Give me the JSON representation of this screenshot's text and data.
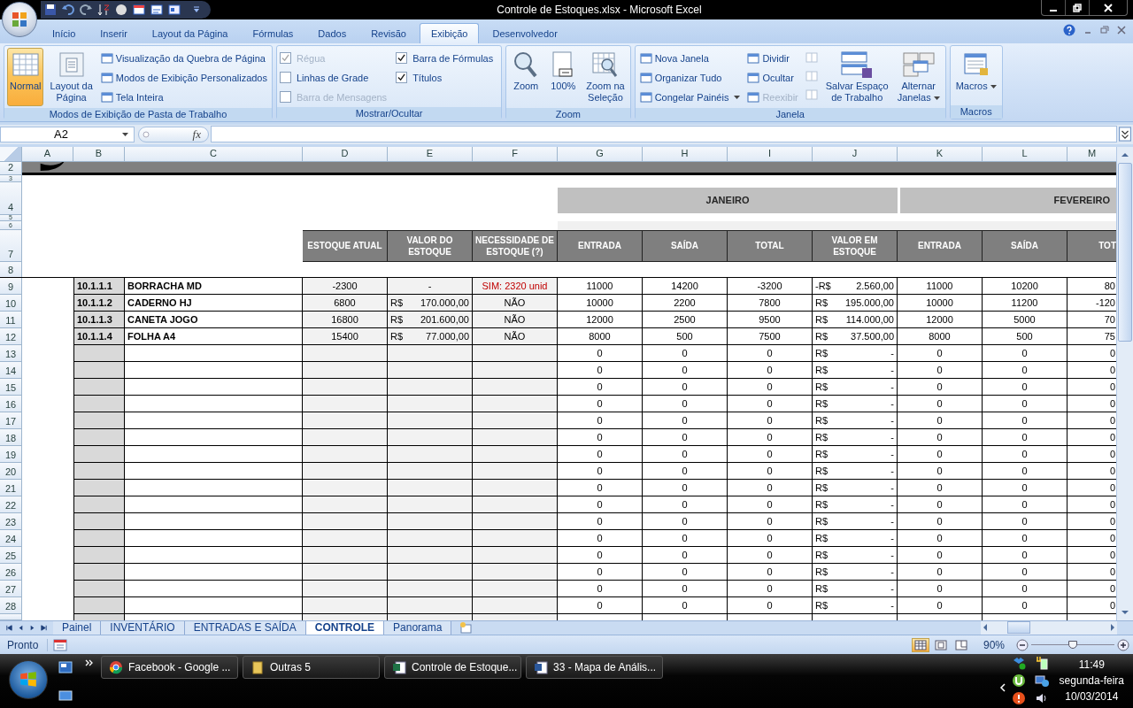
{
  "window": {
    "title": "Controle de Estoques.xlsx - Microsoft Excel"
  },
  "ribbon": {
    "tabs": [
      {
        "label": "Início",
        "selected": false
      },
      {
        "label": "Inserir",
        "selected": false
      },
      {
        "label": "Layout da Página",
        "selected": false
      },
      {
        "label": "Fórmulas",
        "selected": false
      },
      {
        "label": "Dados",
        "selected": false
      },
      {
        "label": "Revisão",
        "selected": false
      },
      {
        "label": "Exibição",
        "selected": true
      },
      {
        "label": "Desenvolvedor",
        "selected": false
      }
    ],
    "groups": [
      {
        "title": "Modos de Exibição de Pasta de Trabalho",
        "columns": [
          [
            {
              "kind": "large",
              "label": "Normal",
              "selected": true
            }
          ],
          [
            {
              "kind": "large",
              "label": "Layout da\nPágina",
              "selected": false
            }
          ],
          [
            {
              "kind": "small",
              "label": "Visualização da Quebra de Página"
            },
            {
              "kind": "small",
              "label": "Modos de Exibição Personalizados"
            },
            {
              "kind": "small",
              "label": "Tela Inteira"
            }
          ]
        ]
      },
      {
        "title": "Mostrar/Ocultar",
        "columns": [
          [
            {
              "kind": "checkbox",
              "label": "Régua",
              "checked": true,
              "disabled": true
            },
            {
              "kind": "checkbox",
              "label": "Linhas de Grade",
              "checked": false,
              "disabled": false
            },
            {
              "kind": "checkbox",
              "label": "Barra de Mensagens",
              "checked": false,
              "disabled": true
            }
          ],
          [
            {
              "kind": "checkbox",
              "label": "Barra de Fórmulas",
              "checked": true,
              "disabled": false
            },
            {
              "kind": "checkbox",
              "label": "Títulos",
              "checked": true,
              "disabled": false
            }
          ]
        ]
      },
      {
        "title": "Zoom",
        "columns": [
          [
            {
              "kind": "large",
              "label": "Zoom"
            }
          ],
          [
            {
              "kind": "large",
              "label": "100%"
            }
          ],
          [
            {
              "kind": "large",
              "label": "Zoom na\nSeleção"
            }
          ]
        ]
      },
      {
        "title": "Janela",
        "columns": [
          [
            {
              "kind": "small",
              "label": "Nova Janela",
              "disabled": false
            },
            {
              "kind": "small",
              "label": "Organizar Tudo",
              "disabled": false
            },
            {
              "kind": "small",
              "label": "Congelar Painéis",
              "dropdown": true,
              "disabled": false
            }
          ],
          [
            {
              "kind": "small",
              "label": "Dividir",
              "disabled": false
            },
            {
              "kind": "small",
              "label": "Ocultar",
              "disabled": false
            },
            {
              "kind": "small",
              "label": "Reexibir",
              "disabled": true
            }
          ],
          [
            {
              "kind": "icon",
              "disabled": true
            },
            {
              "kind": "icon",
              "disabled": true
            },
            {
              "kind": "icon",
              "disabled": true
            }
          ],
          [
            {
              "kind": "large",
              "label": "Salvar Espaço\nde Trabalho"
            }
          ],
          [
            {
              "kind": "large",
              "label": "Alternar\nJanelas",
              "dropdown": true
            }
          ]
        ]
      },
      {
        "title": "Macros",
        "columns": [
          [
            {
              "kind": "large",
              "label": "Macros",
              "dropdown": true
            }
          ]
        ]
      }
    ]
  },
  "formula_bar": {
    "name_box": "A2",
    "function_label": "fx"
  },
  "sheet": {
    "column_headers": [
      "A",
      "B",
      "C",
      "D",
      "E",
      "F",
      "G",
      "H",
      "I",
      "J",
      "K",
      "L",
      "M"
    ],
    "row_headers": [
      "2",
      "3",
      "4",
      "5",
      "6",
      "7",
      "8",
      "9",
      "10",
      "11",
      "12",
      "13",
      "14",
      "15",
      "16",
      "17",
      "18",
      "19",
      "20",
      "21",
      "22",
      "23",
      "24",
      "25",
      "26",
      "27",
      "28"
    ],
    "month_bands": [
      "JANEIRO",
      "FEVEREIRO"
    ],
    "summary_headers": [
      "ESTOQUE ATUAL",
      "VALOR DO ESTOQUE",
      "NECESSIDADE DE ESTOQUE (?)"
    ],
    "monthly_headers": [
      "ENTRADA",
      "SAÍDA",
      "TOTAL",
      "VALOR EM ESTOQUE",
      "ENTRADA",
      "SAÍDA",
      "TOT"
    ],
    "rows": [
      {
        "code": "10.1.1.1",
        "item": "BORRACHA MD",
        "stock": "-2300",
        "stock_value": {
          "amount": "-"
        },
        "need": "SIM: 2320 unid",
        "need_alert": true,
        "jan": [
          "11000",
          "14200",
          "-3200"
        ],
        "jan_value": {
          "currency": "-R$",
          "amount": "2.560,00"
        },
        "feb": [
          "11000",
          "10200",
          "80"
        ]
      },
      {
        "code": "10.1.1.2",
        "item": "CADERNO HJ",
        "stock": "6800",
        "stock_value": {
          "currency": "R$",
          "amount": "170.000,00"
        },
        "need": "NÃO",
        "need_alert": false,
        "jan": [
          "10000",
          "2200",
          "7800"
        ],
        "jan_value": {
          "currency": "R$",
          "amount": "195.000,00"
        },
        "feb": [
          "10000",
          "11200",
          "-120"
        ]
      },
      {
        "code": "10.1.1.3",
        "item": "CANETA JOGO",
        "stock": "16800",
        "stock_value": {
          "currency": "R$",
          "amount": "201.600,00"
        },
        "need": "NÃO",
        "need_alert": false,
        "jan": [
          "12000",
          "2500",
          "9500"
        ],
        "jan_value": {
          "currency": "R$",
          "amount": "114.000,00"
        },
        "feb": [
          "12000",
          "5000",
          "70"
        ]
      },
      {
        "code": "10.1.1.4",
        "item": "FOLHA A4",
        "stock": "15400",
        "stock_value": {
          "currency": "R$",
          "amount": "77.000,00"
        },
        "need": "NÃO",
        "need_alert": false,
        "jan": [
          "8000",
          "500",
          "7500"
        ],
        "jan_value": {
          "currency": "R$",
          "amount": "37.500,00"
        },
        "feb": [
          "8000",
          "500",
          "75"
        ]
      },
      {
        "jan": [
          "0",
          "0",
          "0"
        ],
        "jan_value": {
          "currency": "R$",
          "amount": "-"
        },
        "feb": [
          "0",
          "0",
          "0"
        ]
      },
      {
        "jan": [
          "0",
          "0",
          "0"
        ],
        "jan_value": {
          "currency": "R$",
          "amount": "-"
        },
        "feb": [
          "0",
          "0",
          "0"
        ]
      },
      {
        "jan": [
          "0",
          "0",
          "0"
        ],
        "jan_value": {
          "currency": "R$",
          "amount": "-"
        },
        "feb": [
          "0",
          "0",
          "0"
        ]
      },
      {
        "jan": [
          "0",
          "0",
          "0"
        ],
        "jan_value": {
          "currency": "R$",
          "amount": "-"
        },
        "feb": [
          "0",
          "0",
          "0"
        ]
      },
      {
        "jan": [
          "0",
          "0",
          "0"
        ],
        "jan_value": {
          "currency": "R$",
          "amount": "-"
        },
        "feb": [
          "0",
          "0",
          "0"
        ]
      },
      {
        "jan": [
          "0",
          "0",
          "0"
        ],
        "jan_value": {
          "currency": "R$",
          "amount": "-"
        },
        "feb": [
          "0",
          "0",
          "0"
        ]
      },
      {
        "jan": [
          "0",
          "0",
          "0"
        ],
        "jan_value": {
          "currency": "R$",
          "amount": "-"
        },
        "feb": [
          "0",
          "0",
          "0"
        ]
      },
      {
        "jan": [
          "0",
          "0",
          "0"
        ],
        "jan_value": {
          "currency": "R$",
          "amount": "-"
        },
        "feb": [
          "0",
          "0",
          "0"
        ]
      },
      {
        "jan": [
          "0",
          "0",
          "0"
        ],
        "jan_value": {
          "currency": "R$",
          "amount": "-"
        },
        "feb": [
          "0",
          "0",
          "0"
        ]
      },
      {
        "jan": [
          "0",
          "0",
          "0"
        ],
        "jan_value": {
          "currency": "R$",
          "amount": "-"
        },
        "feb": [
          "0",
          "0",
          "0"
        ]
      },
      {
        "jan": [
          "0",
          "0",
          "0"
        ],
        "jan_value": {
          "currency": "R$",
          "amount": "-"
        },
        "feb": [
          "0",
          "0",
          "0"
        ]
      },
      {
        "jan": [
          "0",
          "0",
          "0"
        ],
        "jan_value": {
          "currency": "R$",
          "amount": "-"
        },
        "feb": [
          "0",
          "0",
          "0"
        ]
      },
      {
        "jan": [
          "0",
          "0",
          "0"
        ],
        "jan_value": {
          "currency": "R$",
          "amount": "-"
        },
        "feb": [
          "0",
          "0",
          "0"
        ]
      },
      {
        "jan": [
          "0",
          "0",
          "0"
        ],
        "jan_value": {
          "currency": "R$",
          "amount": "-"
        },
        "feb": [
          "0",
          "0",
          "0"
        ]
      },
      {
        "jan": [
          "0",
          "0",
          "0"
        ],
        "jan_value": {
          "currency": "R$",
          "amount": "-"
        },
        "feb": [
          "0",
          "0",
          "0"
        ]
      },
      {
        "jan": [
          "0",
          "0",
          "0"
        ],
        "jan_value": {
          "currency": "R$",
          "amount": "-"
        },
        "feb": [
          "0",
          "0",
          "0"
        ]
      }
    ]
  },
  "sheet_tabs": [
    {
      "label": "Painel",
      "selected": false
    },
    {
      "label": "INVENTÁRIO",
      "selected": false
    },
    {
      "label": "ENTRADAS E SAÍDA",
      "selected": false
    },
    {
      "label": "CONTROLE",
      "selected": true
    },
    {
      "label": "Panorama",
      "selected": false
    }
  ],
  "status_bar": {
    "status": "Pronto",
    "view_buttons": [
      {
        "selected": true
      },
      {
        "selected": false
      },
      {
        "selected": false
      }
    ],
    "zoom": "90%",
    "zoom_slider": {
      "level": 0.5
    }
  },
  "taskbar": {
    "buttons": [
      {
        "label": "Facebook - Google ..."
      },
      {
        "label": "Outras 5"
      },
      {
        "label": "Controle de Estoque..."
      },
      {
        "label": "33 - Mapa de Anális..."
      }
    ],
    "tray": {
      "time": "11:49",
      "day": "segunda-feira",
      "date": "10/03/2014"
    }
  }
}
